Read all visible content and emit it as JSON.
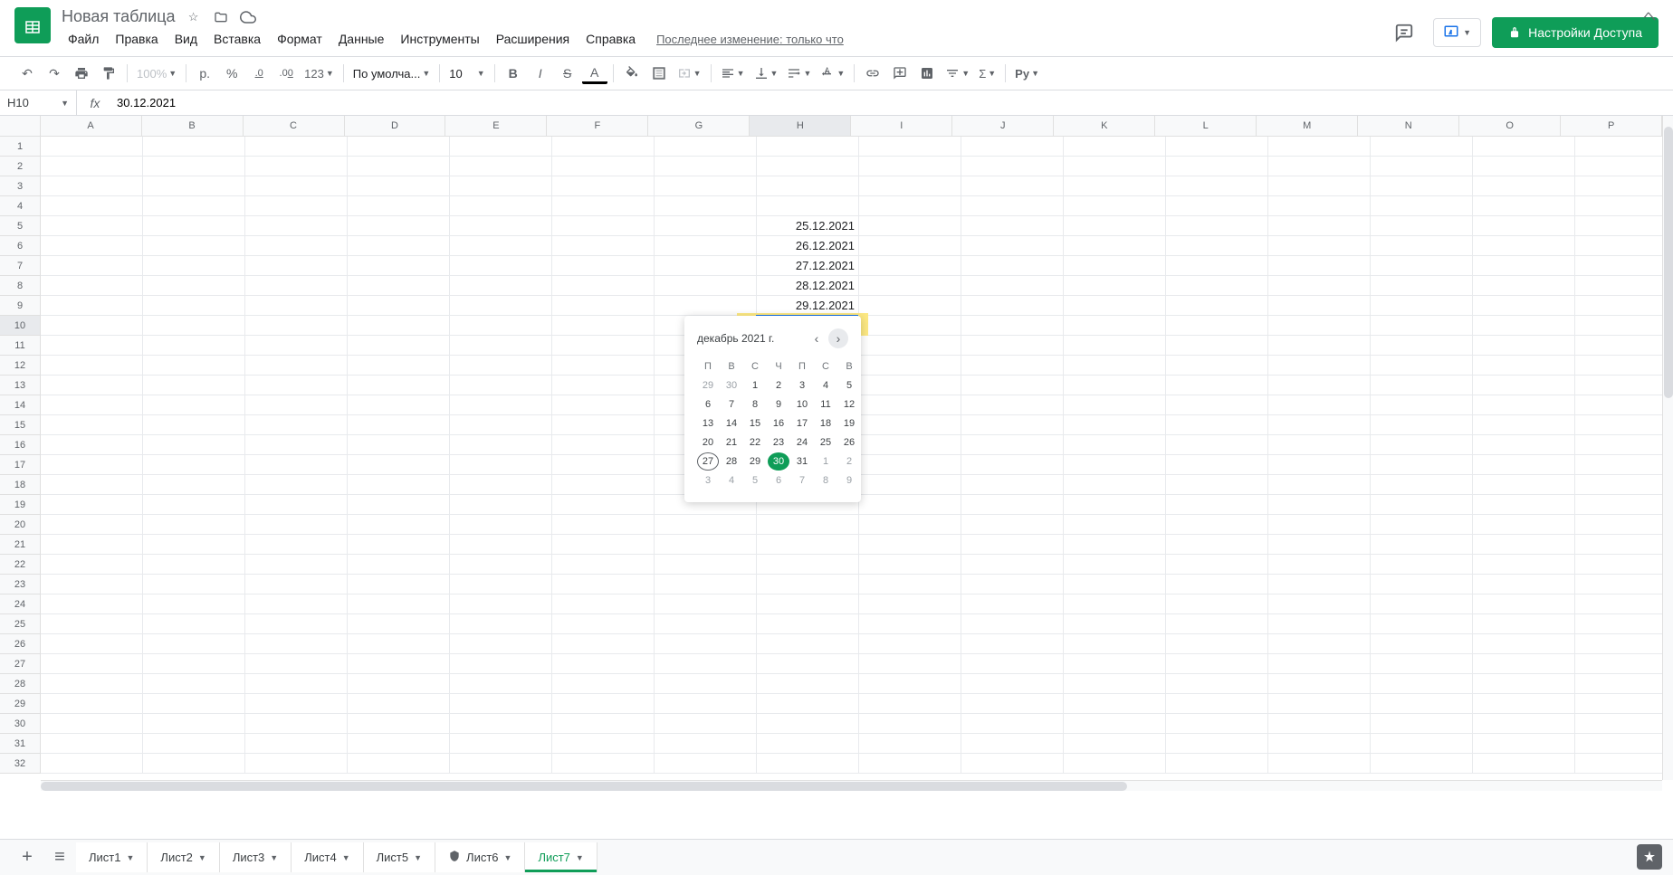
{
  "doc": {
    "title": "Новая таблица"
  },
  "menus": [
    "Файл",
    "Правка",
    "Вид",
    "Вставка",
    "Формат",
    "Данные",
    "Инструменты",
    "Расширения",
    "Справка"
  ],
  "last_edit": "Последнее изменение: только что",
  "share_label": "Настройки Доступа",
  "toolbar": {
    "zoom": "100%",
    "currency": "р.",
    "percent": "%",
    "dec_dec": ".0",
    "inc_dec": ".00",
    "num_fmt": "123",
    "font": "По умолча...",
    "size": "10",
    "py": "Py"
  },
  "namebox": "H10",
  "formula": "30.12.2021",
  "columns": [
    "A",
    "B",
    "C",
    "D",
    "E",
    "F",
    "G",
    "H",
    "I",
    "J",
    "K",
    "L",
    "M",
    "N",
    "O",
    "P"
  ],
  "row_count": 32,
  "active_col_idx": 7,
  "active_row": 10,
  "cells": [
    {
      "row": 5,
      "col": 7,
      "val": "25.12.2021"
    },
    {
      "row": 6,
      "col": 7,
      "val": "26.12.2021"
    },
    {
      "row": 7,
      "col": 7,
      "val": "27.12.2021"
    },
    {
      "row": 8,
      "col": 7,
      "val": "28.12.2021"
    },
    {
      "row": 9,
      "col": 7,
      "val": "29.12.2021"
    },
    {
      "row": 10,
      "col": 7,
      "val": "30.12.2021"
    }
  ],
  "active_cell_val": "30.12.2021",
  "datepicker": {
    "title": "декабрь 2021 г.",
    "weekdays": [
      "П",
      "В",
      "С",
      "Ч",
      "П",
      "С",
      "В"
    ],
    "days": [
      {
        "d": "29",
        "m": true
      },
      {
        "d": "30",
        "m": true
      },
      {
        "d": "1"
      },
      {
        "d": "2"
      },
      {
        "d": "3"
      },
      {
        "d": "4"
      },
      {
        "d": "5"
      },
      {
        "d": "6"
      },
      {
        "d": "7"
      },
      {
        "d": "8"
      },
      {
        "d": "9"
      },
      {
        "d": "10"
      },
      {
        "d": "11"
      },
      {
        "d": "12"
      },
      {
        "d": "13"
      },
      {
        "d": "14"
      },
      {
        "d": "15"
      },
      {
        "d": "16"
      },
      {
        "d": "17"
      },
      {
        "d": "18"
      },
      {
        "d": "19"
      },
      {
        "d": "20"
      },
      {
        "d": "21"
      },
      {
        "d": "22"
      },
      {
        "d": "23"
      },
      {
        "d": "24"
      },
      {
        "d": "25"
      },
      {
        "d": "26"
      },
      {
        "d": "27",
        "today": true
      },
      {
        "d": "28"
      },
      {
        "d": "29"
      },
      {
        "d": "30",
        "sel": true
      },
      {
        "d": "31"
      },
      {
        "d": "1",
        "m": true
      },
      {
        "d": "2",
        "m": true
      },
      {
        "d": "3",
        "m": true
      },
      {
        "d": "4",
        "m": true
      },
      {
        "d": "5",
        "m": true
      },
      {
        "d": "6",
        "m": true
      },
      {
        "d": "7",
        "m": true
      },
      {
        "d": "8",
        "m": true
      },
      {
        "d": "9",
        "m": true
      }
    ]
  },
  "sheets": [
    {
      "name": "Лист1"
    },
    {
      "name": "Лист2"
    },
    {
      "name": "Лист3"
    },
    {
      "name": "Лист4"
    },
    {
      "name": "Лист5"
    },
    {
      "name": "Лист6",
      "protected": true
    },
    {
      "name": "Лист7",
      "active": true
    }
  ]
}
